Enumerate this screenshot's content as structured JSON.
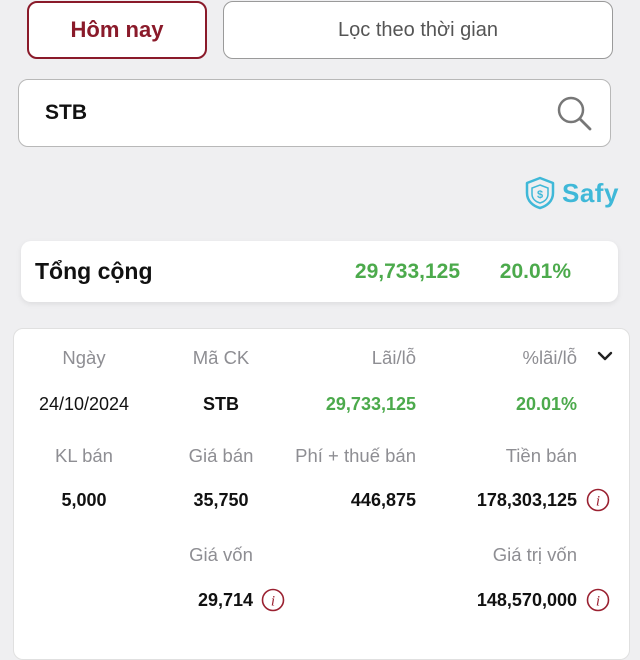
{
  "tabs": {
    "today": "Hôm nay",
    "filter_by_time": "Lọc theo thời gian"
  },
  "search": {
    "value": "STB",
    "icon": "search-icon"
  },
  "brand": {
    "name": "Safy",
    "color": "#3fb8d8"
  },
  "summary": {
    "label": "Tổng cộng",
    "profit": "29,733,125",
    "profit_pct": "20.01%",
    "profit_color": "#4caa4c"
  },
  "record": {
    "headers": {
      "date": "Ngày",
      "symbol": "Mã CK",
      "profit": "Lãi/lỗ",
      "profit_pct": "%lãi/lỗ",
      "sell_volume": "KL bán",
      "sell_price": "Giá bán",
      "fee_tax": "Phí + thuế bán",
      "sell_amount": "Tiền bán",
      "cost_price": "Giá vốn",
      "cost_value": "Giá trị vốn"
    },
    "values": {
      "date": "24/10/2024",
      "symbol": "STB",
      "profit": "29,733,125",
      "profit_pct": "20.01%",
      "sell_volume": "5,000",
      "sell_price": "35,750",
      "fee_tax": "446,875",
      "sell_amount": "178,303,125",
      "cost_price": "29,714",
      "cost_value": "148,570,000"
    }
  },
  "accent_colors": {
    "tab_active": "#8a1a2a",
    "info_icon": "#9a2030"
  }
}
